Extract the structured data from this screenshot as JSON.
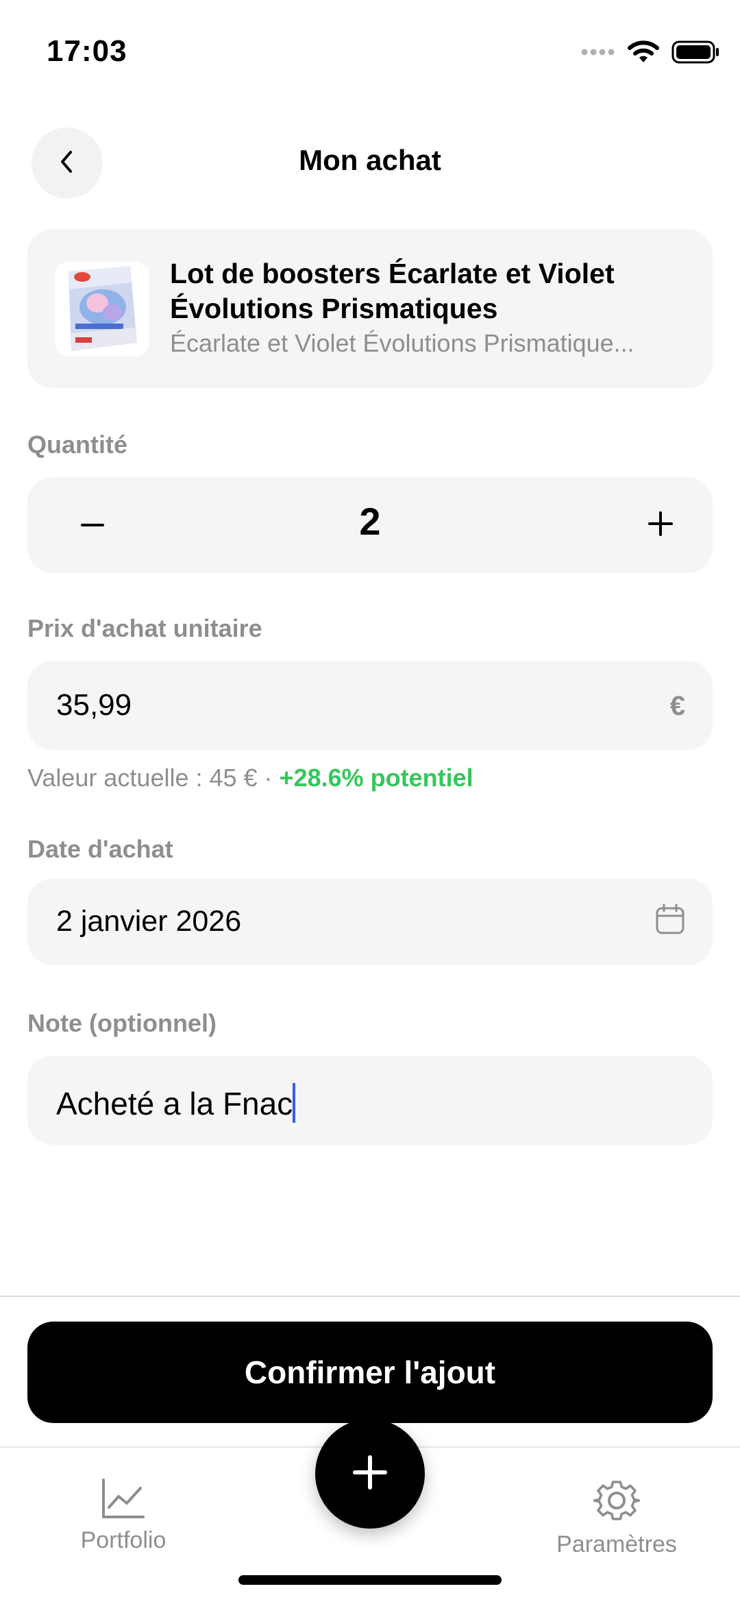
{
  "status_bar": {
    "time": "17:03",
    "icons": [
      "signal-icon",
      "wifi-icon",
      "battery-icon"
    ]
  },
  "header": {
    "title": "Mon achat",
    "back_icon": "chevron-left-icon"
  },
  "product": {
    "name": "Lot de boosters Écarlate et Violet Évolutions Prismatiques",
    "set": "Écarlate et Violet Évolutions Prismatique...",
    "thumbnail_icon": "booster-box-image"
  },
  "quantity": {
    "label": "Quantité",
    "value": "2",
    "minus_symbol": "–",
    "plus_symbol": "+"
  },
  "price": {
    "label": "Prix d'achat unitaire",
    "value": "35,99",
    "currency": "€",
    "hint_prefix": "Valeur actuelle : 45 € · ",
    "hint_potential": "+28.6% potentiel"
  },
  "date": {
    "label": "Date d'achat",
    "value": "2 janvier 2026",
    "icon": "calendar-icon"
  },
  "note": {
    "label": "Note (optionnel)",
    "value": "Acheté a la Fnac"
  },
  "confirm_label": "Confirmer l'ajout",
  "tabbar": {
    "portfolio_label": "Portfolio",
    "settings_label": "Paramètres",
    "add_icon": "plus-icon"
  },
  "colors": {
    "accent_green": "#34c759",
    "field_bg": "#f5f5f5",
    "label_gray": "#8e8e8e",
    "caret_blue": "#3b5bdb"
  }
}
